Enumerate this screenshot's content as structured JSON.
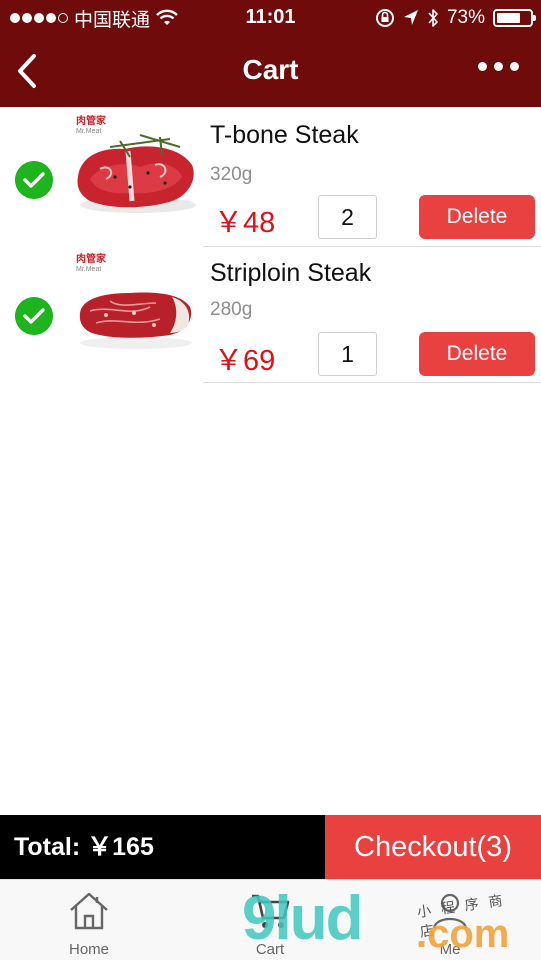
{
  "status_bar": {
    "carrier": "中国联通",
    "time": "11:01",
    "battery_text": "73%",
    "battery_level": 0.73,
    "icons": [
      "signal-dots-icon",
      "wifi-icon",
      "orientation-lock-icon",
      "location-arrow-icon",
      "bluetooth-icon",
      "battery-icon"
    ]
  },
  "navbar": {
    "title": "Cart",
    "back_icon": "chevron-left-icon",
    "more_icon": "more-dots-icon"
  },
  "cart": {
    "items": [
      {
        "name": "T-bone Steak",
        "weight": "320g",
        "price": "￥48",
        "quantity": "2",
        "delete_label": "Delete",
        "selected": true,
        "brand": "肉管家",
        "brand_sub": "Mr.Meat"
      },
      {
        "name": "Striploin Steak",
        "weight": "280g",
        "price": "￥69",
        "quantity": "1",
        "delete_label": "Delete",
        "selected": true,
        "brand": "肉管家",
        "brand_sub": "Mr.Meat"
      }
    ]
  },
  "footer": {
    "total_label": "Total:  ￥165",
    "checkout_label": "Checkout(3)"
  },
  "tabbar": {
    "tabs": [
      {
        "label": "Home",
        "icon": "home-icon"
      },
      {
        "label": "Cart",
        "icon": "cart-icon"
      },
      {
        "label": "Me",
        "icon": "user-icon"
      }
    ]
  },
  "watermark": {
    "main": "9lud",
    "domain": ".com",
    "chinese": "小程序商店"
  },
  "colors": {
    "header": "#6f0b0b",
    "accent_red": "#e94040",
    "price_red": "#e0101a",
    "check_green": "#1db41d",
    "total_bar": "#000000"
  }
}
